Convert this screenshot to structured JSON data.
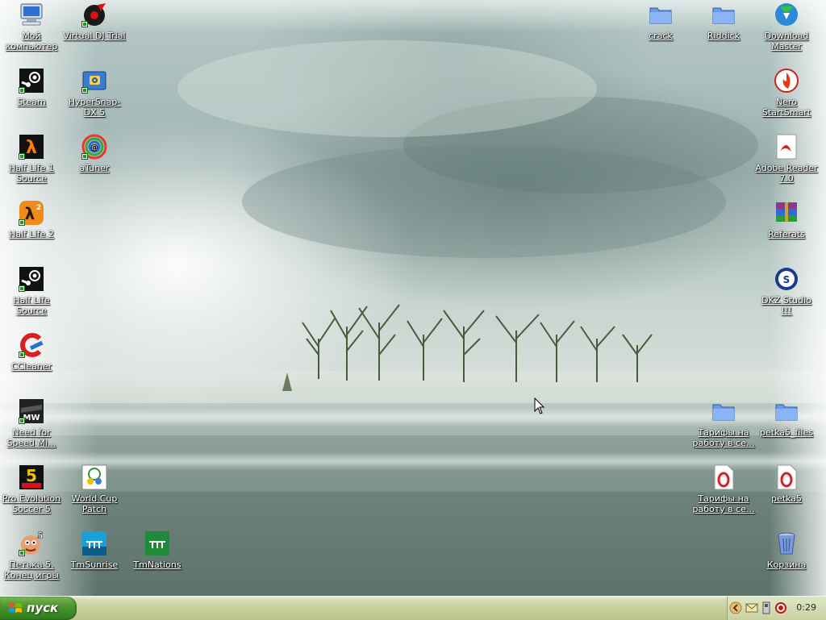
{
  "desktop": {
    "icons": [
      {
        "id": "my-computer",
        "label": "Мой компьютер",
        "icon": "my-computer-icon",
        "shortcut": false
      },
      {
        "id": "virtual-dj",
        "label": "Virtual DJ Trial",
        "icon": "virtual-dj-icon",
        "shortcut": true
      },
      {
        "id": "steam",
        "label": "Steam",
        "icon": "steam-icon",
        "shortcut": true
      },
      {
        "id": "hypersnap",
        "label": "HyperSnap-DX 5",
        "icon": "hypersnap-icon",
        "shortcut": true
      },
      {
        "id": "hl1-source",
        "label": "Half Life 1 Source",
        "icon": "half-life-icon",
        "shortcut": true
      },
      {
        "id": "atuner",
        "label": "aTuner",
        "icon": "atuner-icon",
        "shortcut": true
      },
      {
        "id": "hl2",
        "label": "Half Life 2",
        "icon": "half-life-2-icon",
        "shortcut": true
      },
      {
        "id": "hl-source",
        "label": "Half Life Source",
        "icon": "steam-icon",
        "shortcut": true
      },
      {
        "id": "ccleaner",
        "label": "CCleaner",
        "icon": "ccleaner-icon",
        "shortcut": true
      },
      {
        "id": "nfs-mw",
        "label": "Need for Speed Mi...",
        "icon": "need-for-speed-icon",
        "shortcut": true
      },
      {
        "id": "pes5",
        "label": "Pro Evolution Soccer 5",
        "icon": "pes5-icon",
        "shortcut": true
      },
      {
        "id": "wc-patch",
        "label": "World Cup Patch",
        "icon": "world-cup-icon",
        "shortcut": true
      },
      {
        "id": "petka5",
        "label": "Петька 5. Конец игры",
        "icon": "petka-icon",
        "shortcut": true
      },
      {
        "id": "tmsunrise",
        "label": "TmSunrise",
        "icon": "tmsunrise-icon",
        "shortcut": false
      },
      {
        "id": "tmnations",
        "label": "TmNations",
        "icon": "tmnations-icon",
        "shortcut": false
      },
      {
        "id": "crack",
        "label": "crack",
        "icon": "folder-icon",
        "shortcut": false
      },
      {
        "id": "riddick",
        "label": "Riddick",
        "icon": "folder-icon",
        "shortcut": false
      },
      {
        "id": "download-master",
        "label": "Download Master",
        "icon": "download-master-icon",
        "shortcut": false
      },
      {
        "id": "nero",
        "label": "Nero StartSmart",
        "icon": "nero-icon",
        "shortcut": false
      },
      {
        "id": "adobe-reader",
        "label": "Adobe Reader 7.0",
        "icon": "adobe-reader-icon",
        "shortcut": false
      },
      {
        "id": "referats",
        "label": "Referats",
        "icon": "winrar-icon",
        "shortcut": false
      },
      {
        "id": "dkz-studio",
        "label": "DKZ Studio !!!",
        "icon": "dkz-studio-icon",
        "shortcut": false
      },
      {
        "id": "tarify-folder",
        "label": "Тарифы на работу в се...",
        "icon": "folder-icon",
        "shortcut": false
      },
      {
        "id": "petka5-files",
        "label": "petka5_files",
        "icon": "folder-icon",
        "shortcut": false
      },
      {
        "id": "tarify-opera",
        "label": "Тарифы на работу в се...",
        "icon": "opera-document-icon",
        "shortcut": false
      },
      {
        "id": "petka5-doc",
        "label": "petka5",
        "icon": "opera-document-icon",
        "shortcut": false
      },
      {
        "id": "recycle-bin",
        "label": "Корзина",
        "icon": "recycle-bin-icon",
        "shortcut": false
      }
    ]
  },
  "taskbar": {
    "start_label": "пуск",
    "tray_icons": [
      "show-hidden-chevron-icon",
      "mail-icon",
      "device-icon",
      "antivirus-icon"
    ],
    "clock": "0:29"
  },
  "colors": {
    "taskbar": "#c7d09c",
    "start_button": "#3a8a24",
    "icon_label": "#ffffff"
  }
}
